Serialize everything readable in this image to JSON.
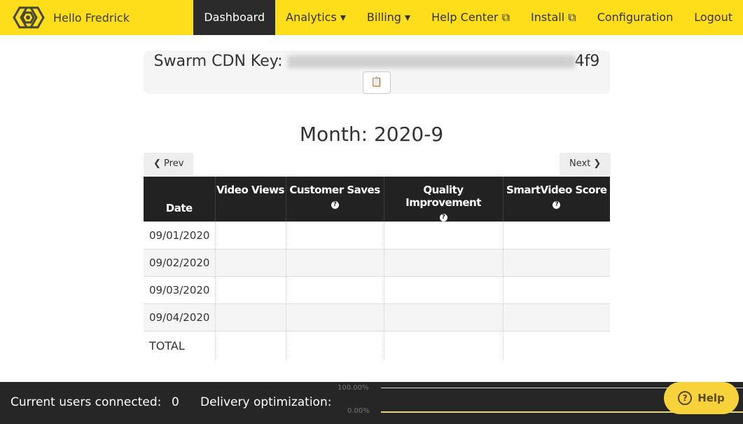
{
  "nav": {
    "greeting": "Hello Fredrick",
    "items": [
      {
        "label": "Dashboard"
      },
      {
        "label": "Analytics ▾"
      },
      {
        "label": "Billing ▾"
      },
      {
        "label": "Help Center ⧉"
      },
      {
        "label": "Install ⧉"
      },
      {
        "label": "Configuration"
      },
      {
        "label": "Logout"
      }
    ],
    "accent": "#fedd1b"
  },
  "key": {
    "label": "Swarm CDN Key:",
    "visible_suffix": "4f9",
    "copy_icon": "clipboard-icon"
  },
  "month": "Month: 2020-9",
  "pager": {
    "prev": "❮ Prev",
    "next": "Next ❯"
  },
  "table": {
    "headers": [
      "Date",
      "Video Views",
      "Customer Saves",
      "Quality Improvement",
      "SmartVideo Score"
    ],
    "rows": [
      "09/01/2020",
      "09/02/2020",
      "09/03/2020",
      "09/04/2020"
    ],
    "total": "TOTAL"
  },
  "footer": {
    "users_label": "Current users connected:",
    "users_value": "0",
    "delivery_label": "Delivery optimization:",
    "axis_top": "100.00%",
    "axis_bottom": "0.00%"
  },
  "help": {
    "label": "Help"
  }
}
